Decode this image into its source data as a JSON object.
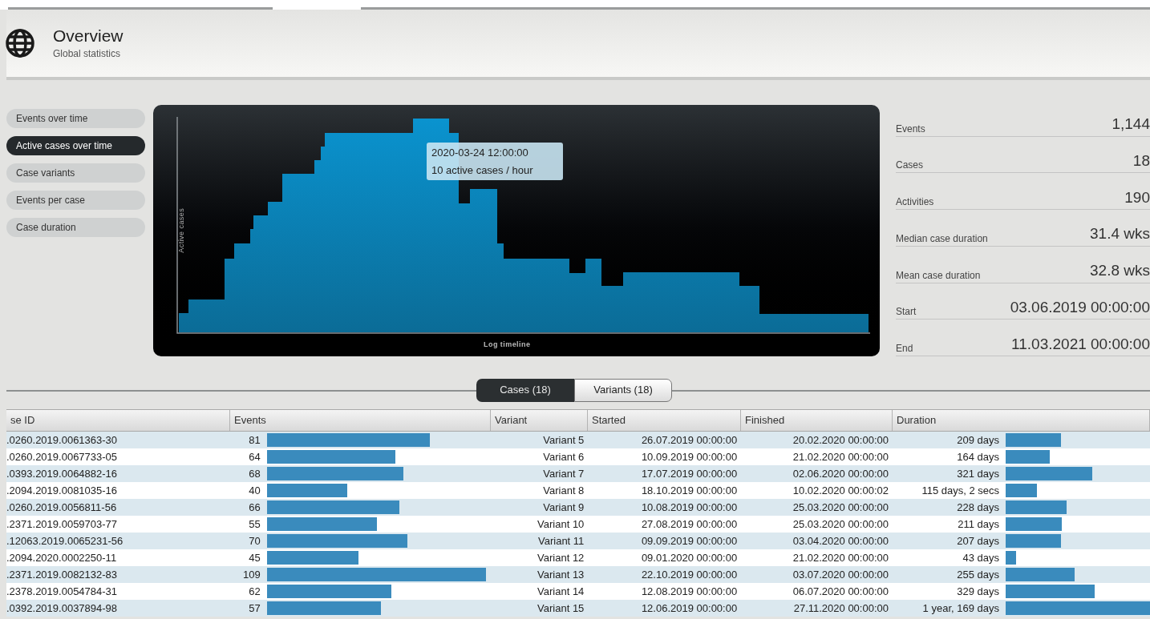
{
  "header": {
    "title": "Overview",
    "subtitle": "Global statistics"
  },
  "views": [
    {
      "label": "Events over time",
      "selected": false
    },
    {
      "label": "Active cases over time",
      "selected": true
    },
    {
      "label": "Case variants",
      "selected": false
    },
    {
      "label": "Events per case",
      "selected": false
    },
    {
      "label": "Case duration",
      "selected": false
    }
  ],
  "chart": {
    "ylabel": "Active cases",
    "xlabel": "Log timeline",
    "tooltip": [
      "2020-03-24 12:00:00",
      "10 active cases / hour"
    ]
  },
  "stats": [
    {
      "label": "Events",
      "value": "1,144"
    },
    {
      "label": "Cases",
      "value": "18"
    },
    {
      "label": "Activities",
      "value": "190"
    },
    {
      "label": "Median case duration",
      "value": "31.4 wks"
    },
    {
      "label": "Mean case duration",
      "value": "32.8 wks"
    },
    {
      "label": "Start",
      "value": "03.06.2019 00:00:00"
    },
    {
      "label": "End",
      "value": "11.03.2021 00:00:00"
    }
  ],
  "tabs": [
    {
      "label": "Cases (18)",
      "selected": true
    },
    {
      "label": "Variants (18)",
      "selected": false
    }
  ],
  "table": {
    "columns": [
      "se ID",
      "Events",
      "Variant",
      "Started",
      "Finished",
      "Duration"
    ],
    "rows": [
      {
        "case_id": ".0260.2019.0061363-30",
        "events": "81",
        "variant": "Variant 5",
        "started": "26.07.2019 00:00:00",
        "finished": "20.02.2020 00:00:00",
        "duration": "209 days"
      },
      {
        "case_id": ".0260.2019.0067733-05",
        "events": "64",
        "variant": "Variant 6",
        "started": "10.09.2019 00:00:00",
        "finished": "21.02.2020 00:00:00",
        "duration": "164 days"
      },
      {
        "case_id": ".0393.2019.0064882-16",
        "events": "68",
        "variant": "Variant 7",
        "started": "17.07.2019 00:00:00",
        "finished": "02.06.2020 00:00:00",
        "duration": "321 days"
      },
      {
        "case_id": ".2094.2019.0081035-16",
        "events": "40",
        "variant": "Variant 8",
        "started": "18.10.2019 00:00:00",
        "finished": "10.02.2020 00:00:02",
        "duration": "115 days, 2 secs"
      },
      {
        "case_id": ".0260.2019.0056811-56",
        "events": "66",
        "variant": "Variant 9",
        "started": "10.08.2019 00:00:00",
        "finished": "25.03.2020 00:00:00",
        "duration": "228 days"
      },
      {
        "case_id": ".2371.2019.0059703-77",
        "events": "55",
        "variant": "Variant 10",
        "started": "27.08.2019 00:00:00",
        "finished": "25.03.2020 00:00:00",
        "duration": "211 days"
      },
      {
        "case_id": ".12063.2019.0065231-56",
        "events": "70",
        "variant": "Variant 11",
        "started": "09.09.2019 00:00:00",
        "finished": "03.04.2020 00:00:00",
        "duration": "207 days"
      },
      {
        "case_id": ".2094.2020.0002250-11",
        "events": "45",
        "variant": "Variant 12",
        "started": "09.01.2020 00:00:00",
        "finished": "21.02.2020 00:00:00",
        "duration": "43 days"
      },
      {
        "case_id": ".2371.2019.0082132-83",
        "events": "109",
        "variant": "Variant 13",
        "started": "22.10.2019 00:00:00",
        "finished": "03.07.2020 00:00:00",
        "duration": "255 days"
      },
      {
        "case_id": ".2378.2019.0054784-31",
        "events": "62",
        "variant": "Variant 14",
        "started": "12.08.2019 00:00:00",
        "finished": "06.07.2020 00:00:00",
        "duration": "329 days"
      },
      {
        "case_id": ".0392.2019.0037894-98",
        "events": "57",
        "variant": "Variant 15",
        "started": "12.06.2019 00:00:00",
        "finished": "27.11.2020 00:00:00",
        "duration": "1 year, 169 days"
      }
    ]
  }
}
